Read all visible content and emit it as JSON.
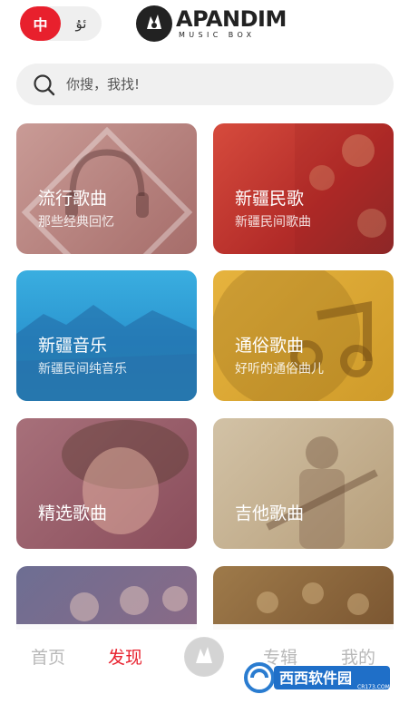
{
  "header": {
    "lang_zh": "中",
    "lang_ug": "ئۇ",
    "logo_name": "APANDIM",
    "logo_sub": "MUSIC BOX"
  },
  "search": {
    "placeholder": "你搜，我找!"
  },
  "categories": [
    {
      "title": "流行歌曲",
      "subtitle": "那些经典回忆"
    },
    {
      "title": "新疆民歌",
      "subtitle": "新疆民间歌曲"
    },
    {
      "title": "新疆音乐",
      "subtitle": "新疆民间纯音乐"
    },
    {
      "title": "通俗歌曲",
      "subtitle": "好听的通俗曲儿"
    },
    {
      "title": "精选歌曲",
      "subtitle": ""
    },
    {
      "title": "吉他歌曲",
      "subtitle": ""
    }
  ],
  "bottom_nav": {
    "items": [
      {
        "label": "首页",
        "active": false
      },
      {
        "label": "发现",
        "active": true
      },
      {
        "label": "专辑",
        "active": false
      },
      {
        "label": "我的",
        "active": false
      }
    ]
  },
  "colors": {
    "accent": "#e8202d",
    "inactive": "#b8b8b8"
  },
  "watermark": {
    "text": "西西软件园",
    "url_text": "CR173.COM"
  }
}
